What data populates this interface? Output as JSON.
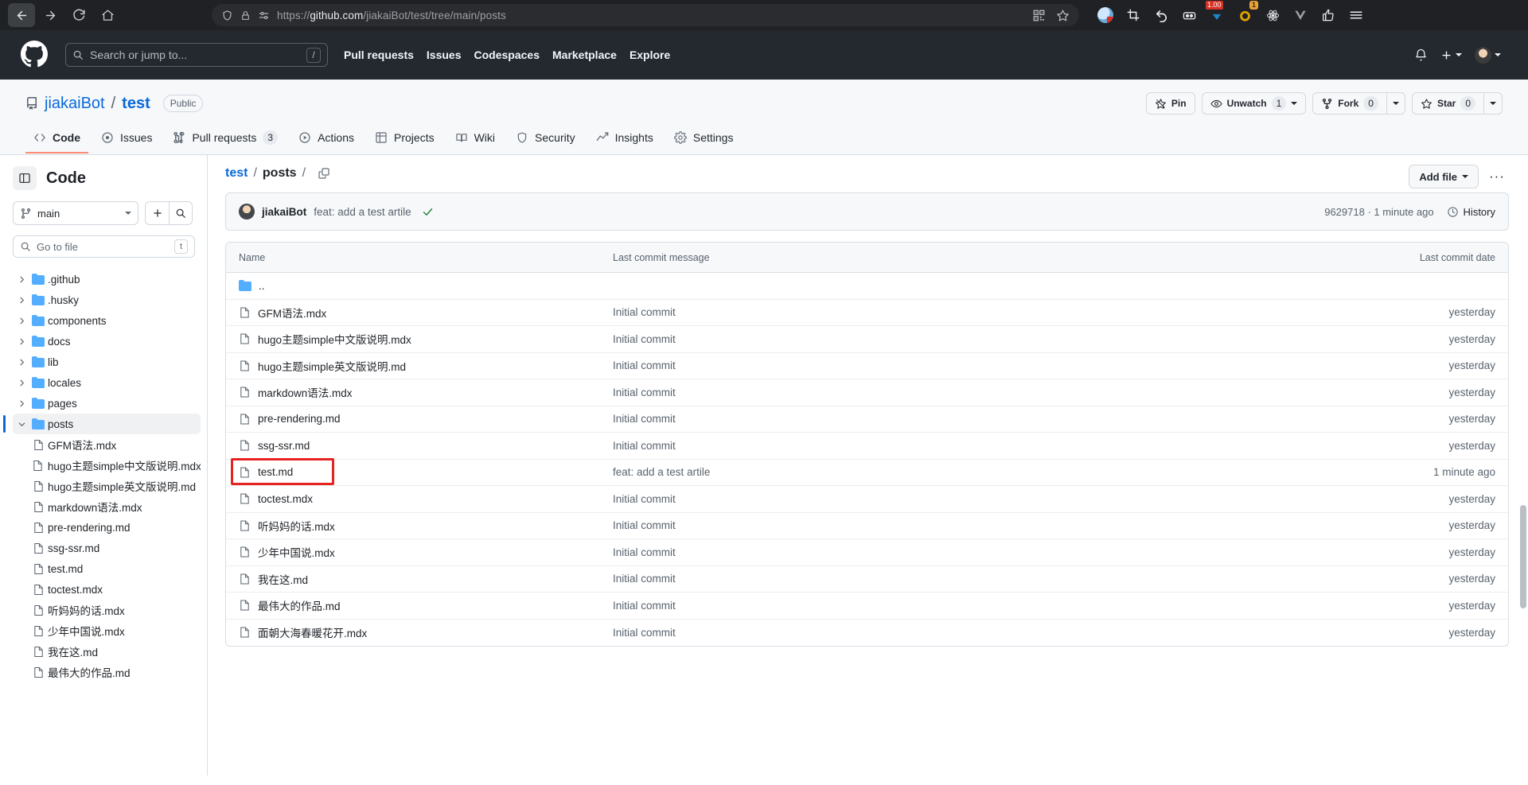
{
  "browser": {
    "nav": {
      "back": "back-arrow",
      "forward": "forward-arrow",
      "reload": "reload",
      "home": "home"
    },
    "url_prefix": "https://",
    "url_domain": "github.com",
    "url_path": "/jiakaiBot/test/tree/main/posts",
    "url_full": "https://github.com/jiakaiBot/test/tree/main/posts",
    "icons": [
      "shield-icon",
      "lock-icon",
      "permissions-icon",
      "qr-code-icon",
      "bookmark-star-icon"
    ],
    "extensions": [
      {
        "name": "profile-avatar-icon",
        "badge": ""
      },
      {
        "name": "crop-icon",
        "badge": ""
      },
      {
        "name": "undo-arrow-icon",
        "badge": ""
      },
      {
        "name": "zotero-icon",
        "badge": ""
      },
      {
        "name": "video-flag-icon",
        "badge": "1.00"
      },
      {
        "name": "ring-icon",
        "badge": "1"
      },
      {
        "name": "react-devtools-icon",
        "badge": ""
      },
      {
        "name": "vue-devtools-icon",
        "badge": ""
      },
      {
        "name": "thumbs-up-icon",
        "badge": ""
      },
      {
        "name": "chrome-menu-icon",
        "badge": ""
      }
    ]
  },
  "gh_header": {
    "logo": "github-mark-icon",
    "search_placeholder": "Search or jump to...",
    "search_shortcut": "/",
    "nav": [
      "Pull requests",
      "Issues",
      "Codespaces",
      "Marketplace",
      "Explore"
    ],
    "bell": "notifications-bell-icon",
    "plus": "+",
    "avatar": "user-avatar"
  },
  "repo": {
    "owner": "jiakaiBot",
    "separator": "/",
    "name": "test",
    "visibility": "Public",
    "actions": {
      "pin": "Pin",
      "unwatch": "Unwatch",
      "unwatch_count": "1",
      "fork": "Fork",
      "fork_count": "0",
      "star": "Star",
      "star_count": "0"
    },
    "tabs": [
      {
        "label": "Code",
        "icon": "code-icon",
        "count": "",
        "selected": true
      },
      {
        "label": "Issues",
        "icon": "issue-opened-icon",
        "count": "",
        "selected": false
      },
      {
        "label": "Pull requests",
        "icon": "git-pull-request-icon",
        "count": "3",
        "selected": false
      },
      {
        "label": "Actions",
        "icon": "play-icon",
        "count": "",
        "selected": false
      },
      {
        "label": "Projects",
        "icon": "table-icon",
        "count": "",
        "selected": false
      },
      {
        "label": "Wiki",
        "icon": "book-icon",
        "count": "",
        "selected": false
      },
      {
        "label": "Security",
        "icon": "shield-icon",
        "count": "",
        "selected": false
      },
      {
        "label": "Insights",
        "icon": "graph-icon",
        "count": "",
        "selected": false
      },
      {
        "label": "Settings",
        "icon": "gear-icon",
        "count": "",
        "selected": false
      }
    ]
  },
  "sidebar": {
    "title": "Code",
    "panel_toggle": "sidebar-collapse-icon",
    "branch": "main",
    "add_icon": "+",
    "search_icon": "search-icon",
    "filefinder_placeholder": "Go to file",
    "filefinder_shortcut": "t",
    "tree": [
      {
        "name": ".github",
        "type": "dir",
        "expanded": false
      },
      {
        "name": ".husky",
        "type": "dir",
        "expanded": false
      },
      {
        "name": "components",
        "type": "dir",
        "expanded": false
      },
      {
        "name": "docs",
        "type": "dir",
        "expanded": false
      },
      {
        "name": "lib",
        "type": "dir",
        "expanded": false
      },
      {
        "name": "locales",
        "type": "dir",
        "expanded": false
      },
      {
        "name": "pages",
        "type": "dir",
        "expanded": false
      },
      {
        "name": "posts",
        "type": "dir",
        "expanded": true,
        "active": true
      },
      {
        "name": "GFM语法.mdx",
        "type": "file"
      },
      {
        "name": "hugo主题simple中文版说明.mdx",
        "type": "file"
      },
      {
        "name": "hugo主题simple英文版说明.md",
        "type": "file"
      },
      {
        "name": "markdown语法.mdx",
        "type": "file"
      },
      {
        "name": "pre-rendering.md",
        "type": "file"
      },
      {
        "name": "ssg-ssr.md",
        "type": "file"
      },
      {
        "name": "test.md",
        "type": "file"
      },
      {
        "name": "toctest.mdx",
        "type": "file"
      },
      {
        "name": "听妈妈的话.mdx",
        "type": "file"
      },
      {
        "name": "少年中国说.mdx",
        "type": "file"
      },
      {
        "name": "我在这.md",
        "type": "file"
      },
      {
        "name": "最伟大的作品.md",
        "type": "file"
      }
    ]
  },
  "content": {
    "breadcrumb": {
      "repo": "test",
      "folder": "posts",
      "slash": "/",
      "copy_icon": "copy-path-icon"
    },
    "add_file_label": "Add file",
    "more_options": "···",
    "commit": {
      "author": "jiakaiBot",
      "message": "feat: add a test artile",
      "status_icon": "check-success-icon",
      "sha": "9629718",
      "time": "1 minute ago",
      "sha_and_time": "9629718 · 1 minute ago",
      "history_label": "History",
      "history_icon": "history-clock-icon"
    },
    "table": {
      "columns": [
        "Name",
        "Last commit message",
        "Last commit date"
      ],
      "rows": [
        {
          "name": "..",
          "type": "dir-up",
          "message": "",
          "date": ""
        },
        {
          "name": "GFM语法.mdx",
          "type": "file",
          "message": "Initial commit",
          "date": "yesterday"
        },
        {
          "name": "hugo主题simple中文版说明.mdx",
          "type": "file",
          "message": "Initial commit",
          "date": "yesterday"
        },
        {
          "name": "hugo主题simple英文版说明.md",
          "type": "file",
          "message": "Initial commit",
          "date": "yesterday"
        },
        {
          "name": "markdown语法.mdx",
          "type": "file",
          "message": "Initial commit",
          "date": "yesterday"
        },
        {
          "name": "pre-rendering.md",
          "type": "file",
          "message": "Initial commit",
          "date": "yesterday"
        },
        {
          "name": "ssg-ssr.md",
          "type": "file",
          "message": "Initial commit",
          "date": "yesterday"
        },
        {
          "name": "test.md",
          "type": "file",
          "message": "feat: add a test artile",
          "date": "1 minute ago",
          "highlighted": true
        },
        {
          "name": "toctest.mdx",
          "type": "file",
          "message": "Initial commit",
          "date": "yesterday"
        },
        {
          "name": "听妈妈的话.mdx",
          "type": "file",
          "message": "Initial commit",
          "date": "yesterday"
        },
        {
          "name": "少年中国说.mdx",
          "type": "file",
          "message": "Initial commit",
          "date": "yesterday"
        },
        {
          "name": "我在这.md",
          "type": "file",
          "message": "Initial commit",
          "date": "yesterday"
        },
        {
          "name": "最伟大的作品.md",
          "type": "file",
          "message": "Initial commit",
          "date": "yesterday"
        },
        {
          "name": "面朝大海春暖花开.mdx",
          "type": "file",
          "message": "Initial commit",
          "date": "yesterday"
        }
      ]
    }
  },
  "colors": {
    "accent": "#0969da",
    "highlight_box": "#e52421",
    "tab_active_underline": "#fd8c73",
    "folder_blue": "#54aeff",
    "success_green": "#1a7f37"
  }
}
